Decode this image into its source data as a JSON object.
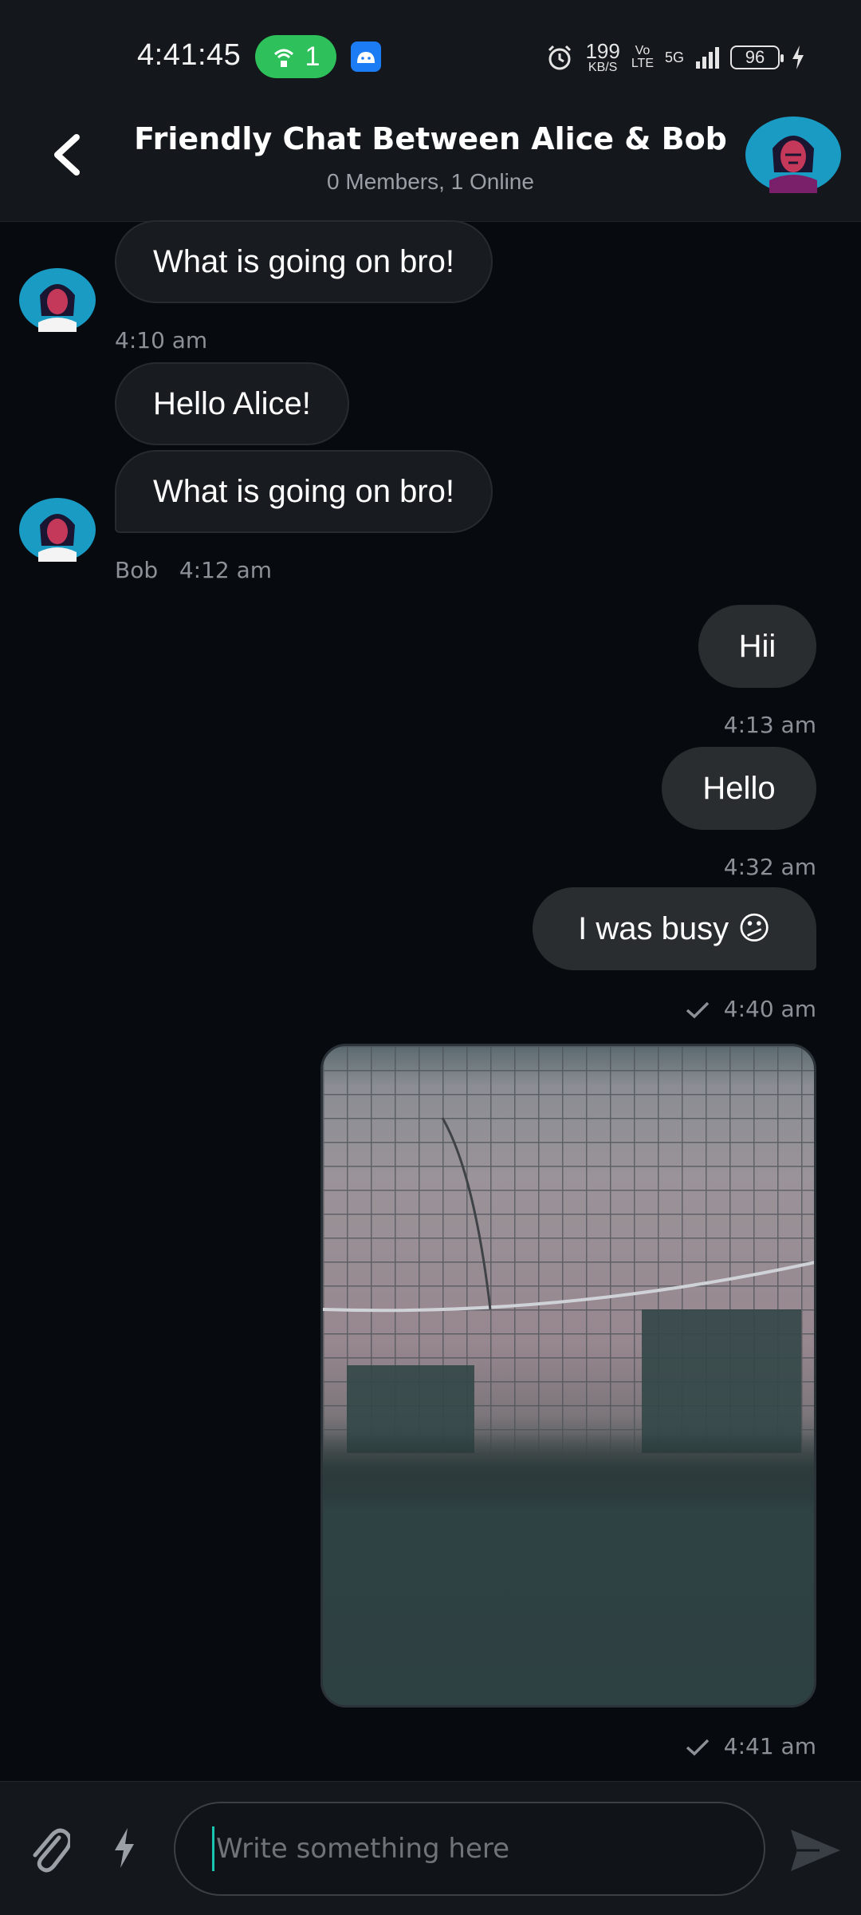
{
  "status_bar": {
    "time": "4:41:45",
    "hotspot_count": "1",
    "net_speed": "199",
    "net_speed_unit": "KB/S",
    "volte_top": "Vo",
    "volte_bottom": "LTE",
    "network_type": "5G",
    "battery": "96"
  },
  "header": {
    "title": "Friendly Chat Between Alice & Bob",
    "subtitle": "0 Members, 1 Online"
  },
  "messages": [
    {
      "text": "What is going on bro!",
      "direction": "in"
    },
    {
      "time": "4:10 am"
    },
    {
      "text": "Hello Alice!",
      "direction": "in"
    },
    {
      "text": "What is going on bro!",
      "direction": "in",
      "sender": "Bob",
      "time": "4:12 am"
    },
    {
      "text": "Hii",
      "direction": "out",
      "time": "4:13 am"
    },
    {
      "text": "Hello",
      "direction": "out",
      "time": "4:32 am"
    },
    {
      "text": "I was busy 😕",
      "direction": "out",
      "time": "4:40 am"
    },
    {
      "type": "image",
      "direction": "out",
      "time": "4:41 am"
    }
  ],
  "composer": {
    "placeholder": "Write something here"
  },
  "colors": {
    "background": "#070b10",
    "accent_caret": "#19c7b1",
    "hotspot_green": "#2ec05a"
  }
}
